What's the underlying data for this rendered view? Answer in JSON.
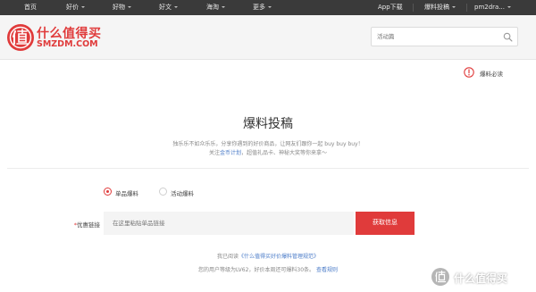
{
  "topnav": {
    "items": [
      {
        "label": "首页",
        "has_caret": false
      },
      {
        "label": "好价",
        "has_caret": true
      },
      {
        "label": "好物",
        "has_caret": true
      },
      {
        "label": "好文",
        "has_caret": true
      },
      {
        "label": "海淘",
        "has_caret": true
      },
      {
        "label": "更多",
        "has_caret": true
      }
    ],
    "right": {
      "app_download": "App下载",
      "submit_deal": "爆料投稿",
      "username": "pm2dra..."
    }
  },
  "header": {
    "logo_cn": "什么值得买",
    "logo_en": "SMZDM.COM",
    "search_placeholder": "活动篇"
  },
  "must_read": {
    "label": "爆料必读"
  },
  "main": {
    "title": "爆料投稿",
    "intro_line1": "独乐乐不如众乐乐，分享你遇到的好价商品，让网友们跟你一起 buy buy buy！",
    "intro_line2_prefix": "关注",
    "intro_line2_link": "金币计划",
    "intro_line2_suffix": "，超值礼品卡、神秘大奖等你来拿～"
  },
  "radios": [
    {
      "label": "单品爆料",
      "selected": true
    },
    {
      "label": "活动爆料",
      "selected": false
    }
  ],
  "form": {
    "required_mark": "*",
    "link_label": "优惠链接",
    "link_placeholder": "在这里粘贴单品链接",
    "fetch_button": "获取信息"
  },
  "footer": {
    "agree_prefix": "我已阅读",
    "agree_link": "《什么值得买好价爆料管理规范》",
    "level_text": "您的用户等级为LV62，好价本周还可爆料30条。",
    "level_link": "查看规则"
  },
  "watermark": {
    "text": "什么值得买"
  },
  "colors": {
    "brand_red": "#e03b3b",
    "nav_bg": "#3a3a3a",
    "link_blue": "#4a7bc8"
  }
}
